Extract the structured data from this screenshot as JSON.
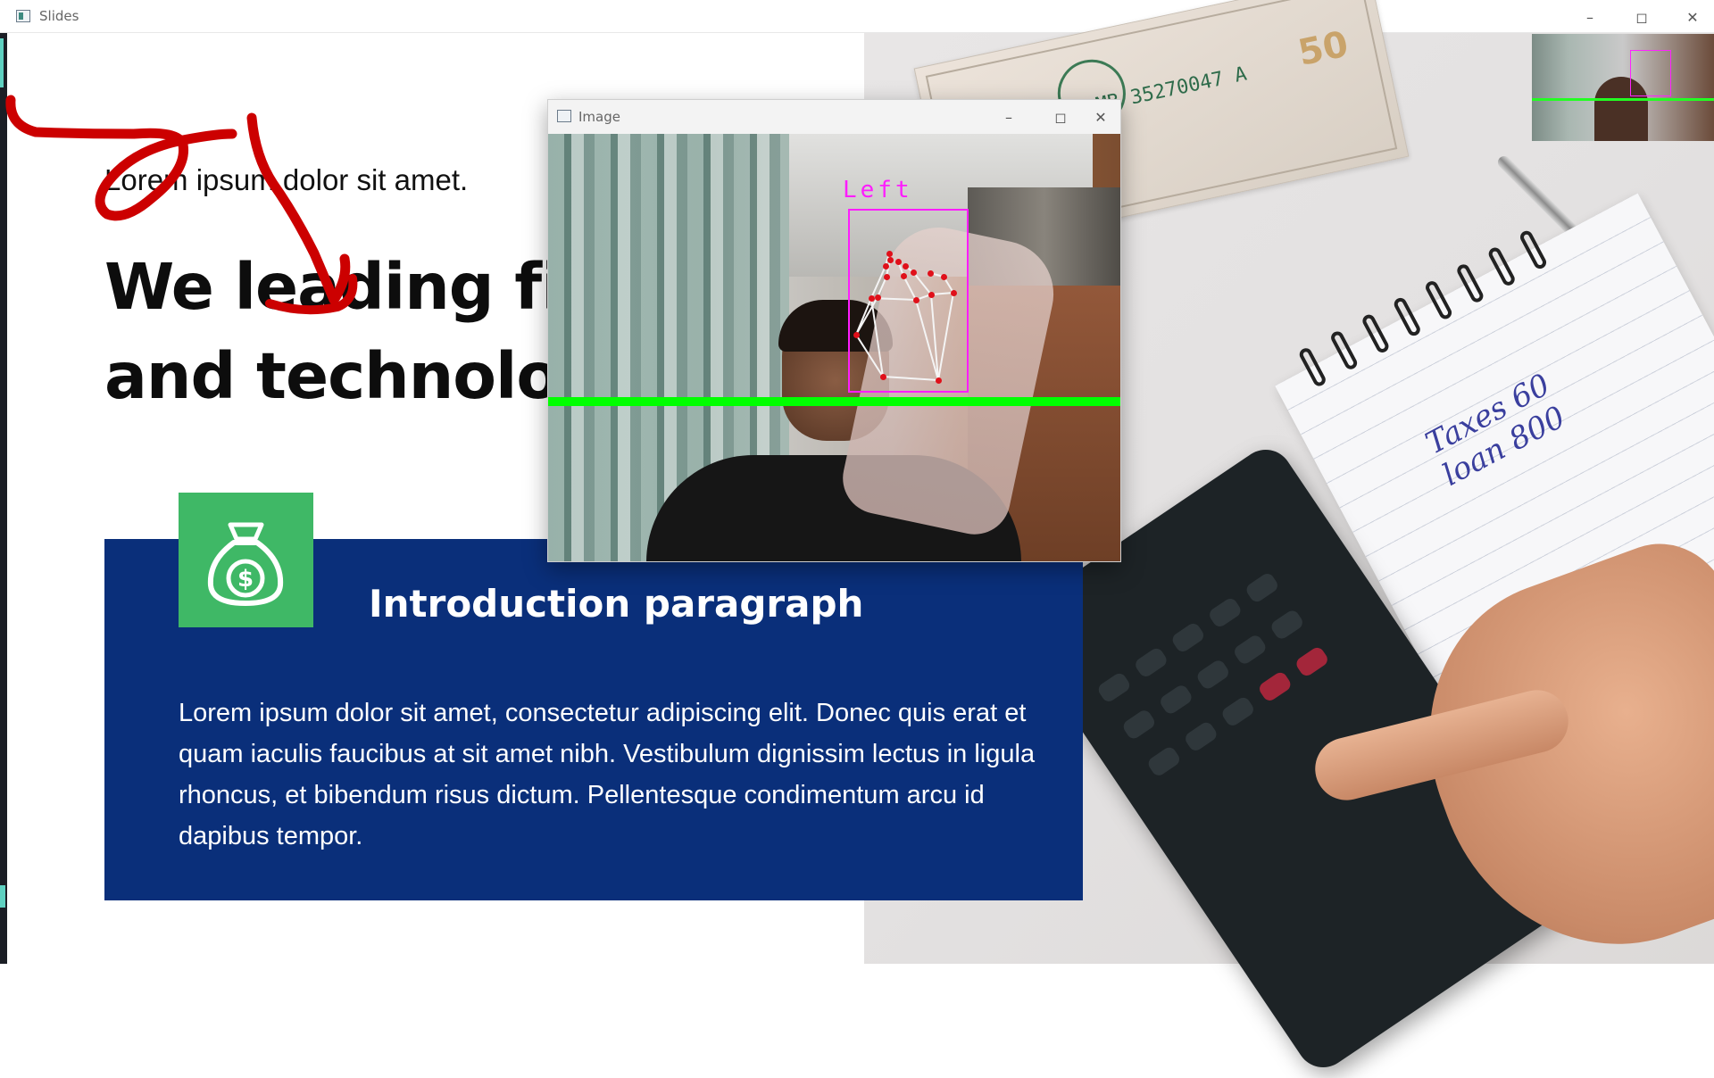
{
  "window": {
    "title": "Slides",
    "controls": [
      "minimize",
      "maximize",
      "close"
    ]
  },
  "slide": {
    "subtitle": "Lorem ipsum dolor sit amet.",
    "headline_line1": "We leading fin",
    "headline_line2": "and technolog",
    "card": {
      "title": "Introduction paragraph",
      "body": "Lorem ipsum dolor sit amet, consectetur adipiscing elit. Donec quis erat et quam iaculis faucibus at sit amet nibh. Vestibulum dignissim lectus in ligula rhoncus, et bibendum risus dictum. Pellentesque condimentum arcu id dapibus tempor.",
      "icon": "money-bag-dollar-icon"
    },
    "photo": {
      "bill_serial": "MB 35270047 A",
      "bill_value": "50",
      "note_line1": "Taxes 60",
      "note_line2": "loan 800"
    }
  },
  "image_window": {
    "title": "Image",
    "detection_label": "Left",
    "colors": {
      "threshold_line": "#00ff00",
      "bounding_box": "#ff1cff",
      "landmarks": "#e0101a"
    }
  },
  "colors": {
    "card_bg": "#0a2f7a",
    "badge_bg": "#3fb866",
    "annotation_ink": "#cc0000"
  }
}
